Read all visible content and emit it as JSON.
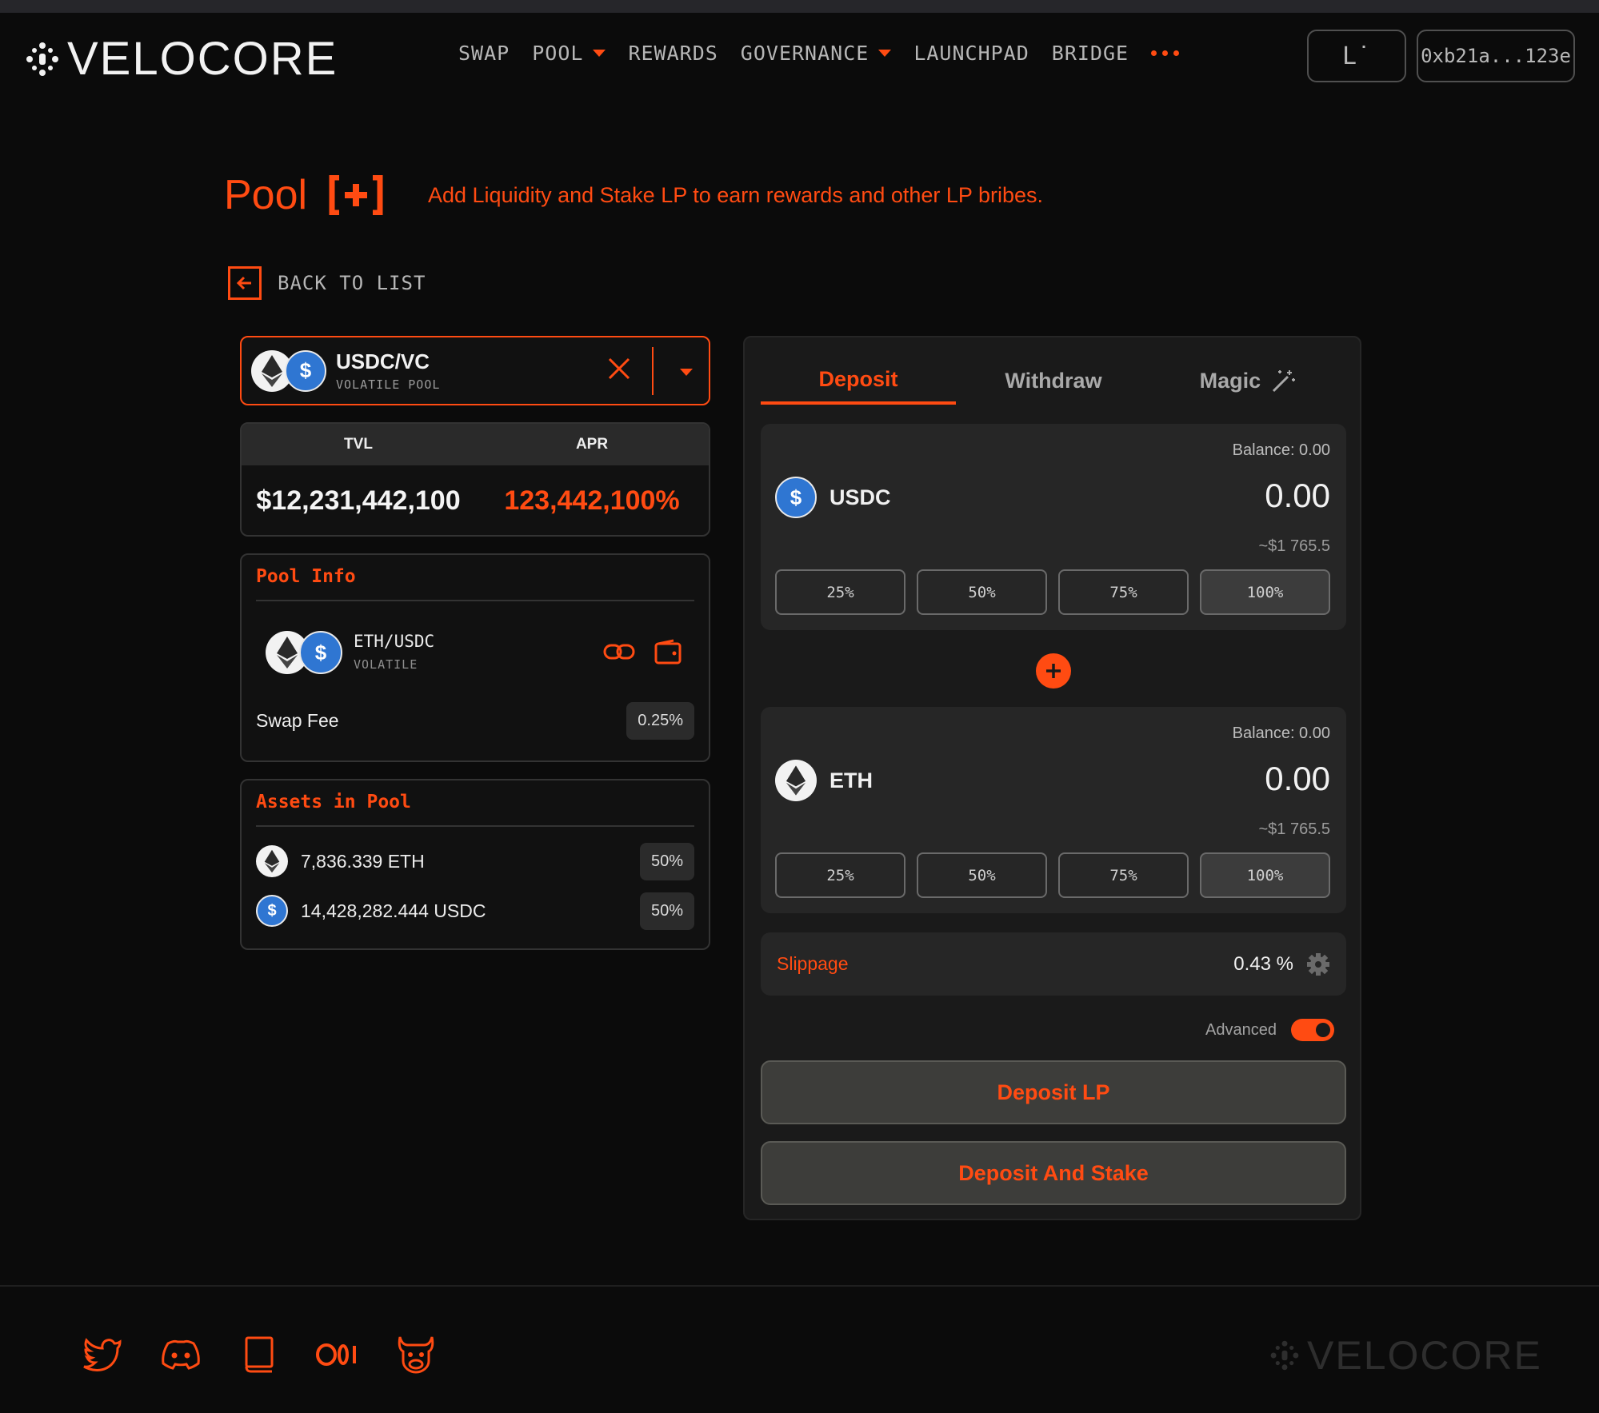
{
  "header": {
    "brand": "VELOCORE",
    "nav": [
      {
        "label": "SWAP",
        "dropdown": false
      },
      {
        "label": "POOL",
        "dropdown": true
      },
      {
        "label": "REWARDS",
        "dropdown": false
      },
      {
        "label": "GOVERNANCE",
        "dropdown": true
      },
      {
        "label": "LAUNCHPAD",
        "dropdown": false
      },
      {
        "label": "BRIDGE",
        "dropdown": false
      }
    ],
    "network_button": "L˙",
    "wallet_address": "0xb21a...123e"
  },
  "page": {
    "title": "Pool",
    "subtitle": "Add Liquidity and Stake LP to earn rewards and other LP bribes.",
    "back_label": "BACK TO LIST"
  },
  "selector": {
    "pair": "USDC/VC",
    "type": "VOLATILE POOL"
  },
  "stats": {
    "tvl_label": "TVL",
    "apr_label": "APR",
    "tvl_value": "$12,231,442,100",
    "apr_value": "123,442,100%"
  },
  "pool_info": {
    "title": "Pool Info",
    "pair": "ETH/USDC",
    "type": "VOLATILE",
    "swap_fee_label": "Swap Fee",
    "swap_fee_value": "0.25%"
  },
  "assets": {
    "title": "Assets in Pool",
    "rows": [
      {
        "amount": "7,836.339 ETH",
        "share": "50%",
        "icon": "eth-icon"
      },
      {
        "amount": "14,428,282.444 USDC",
        "share": "50%",
        "icon": "usdc-icon"
      }
    ]
  },
  "panel": {
    "tabs": [
      {
        "label": "Deposit",
        "active": true
      },
      {
        "label": "Withdraw",
        "active": false
      },
      {
        "label": "Magic",
        "active": false
      }
    ],
    "tokens": [
      {
        "symbol": "USDC",
        "balance": "Balance: 0.00",
        "amount": "0.00",
        "usd": "~$1 765.5",
        "pcts": [
          "25%",
          "50%",
          "75%",
          "100%"
        ]
      },
      {
        "symbol": "ETH",
        "balance": "Balance: 0.00",
        "amount": "0.00",
        "usd": "~$1 765.5",
        "pcts": [
          "25%",
          "50%",
          "75%",
          "100%"
        ]
      }
    ],
    "slippage_label": "Slippage",
    "slippage_value": "0.43 %",
    "advanced_label": "Advanced",
    "advanced_on": true,
    "deposit_lp": "Deposit LP",
    "deposit_stake": "Deposit And Stake"
  },
  "footer": {
    "brand": "VELOCORE",
    "socials": [
      "twitter-icon",
      "discord-icon",
      "docs-icon",
      "medium-icon",
      "bull-icon"
    ]
  },
  "colors": {
    "accent": "#ff4b12",
    "background": "#0b0b0b",
    "panel": "#1a1a1a",
    "usdc": "#2f76d2"
  }
}
